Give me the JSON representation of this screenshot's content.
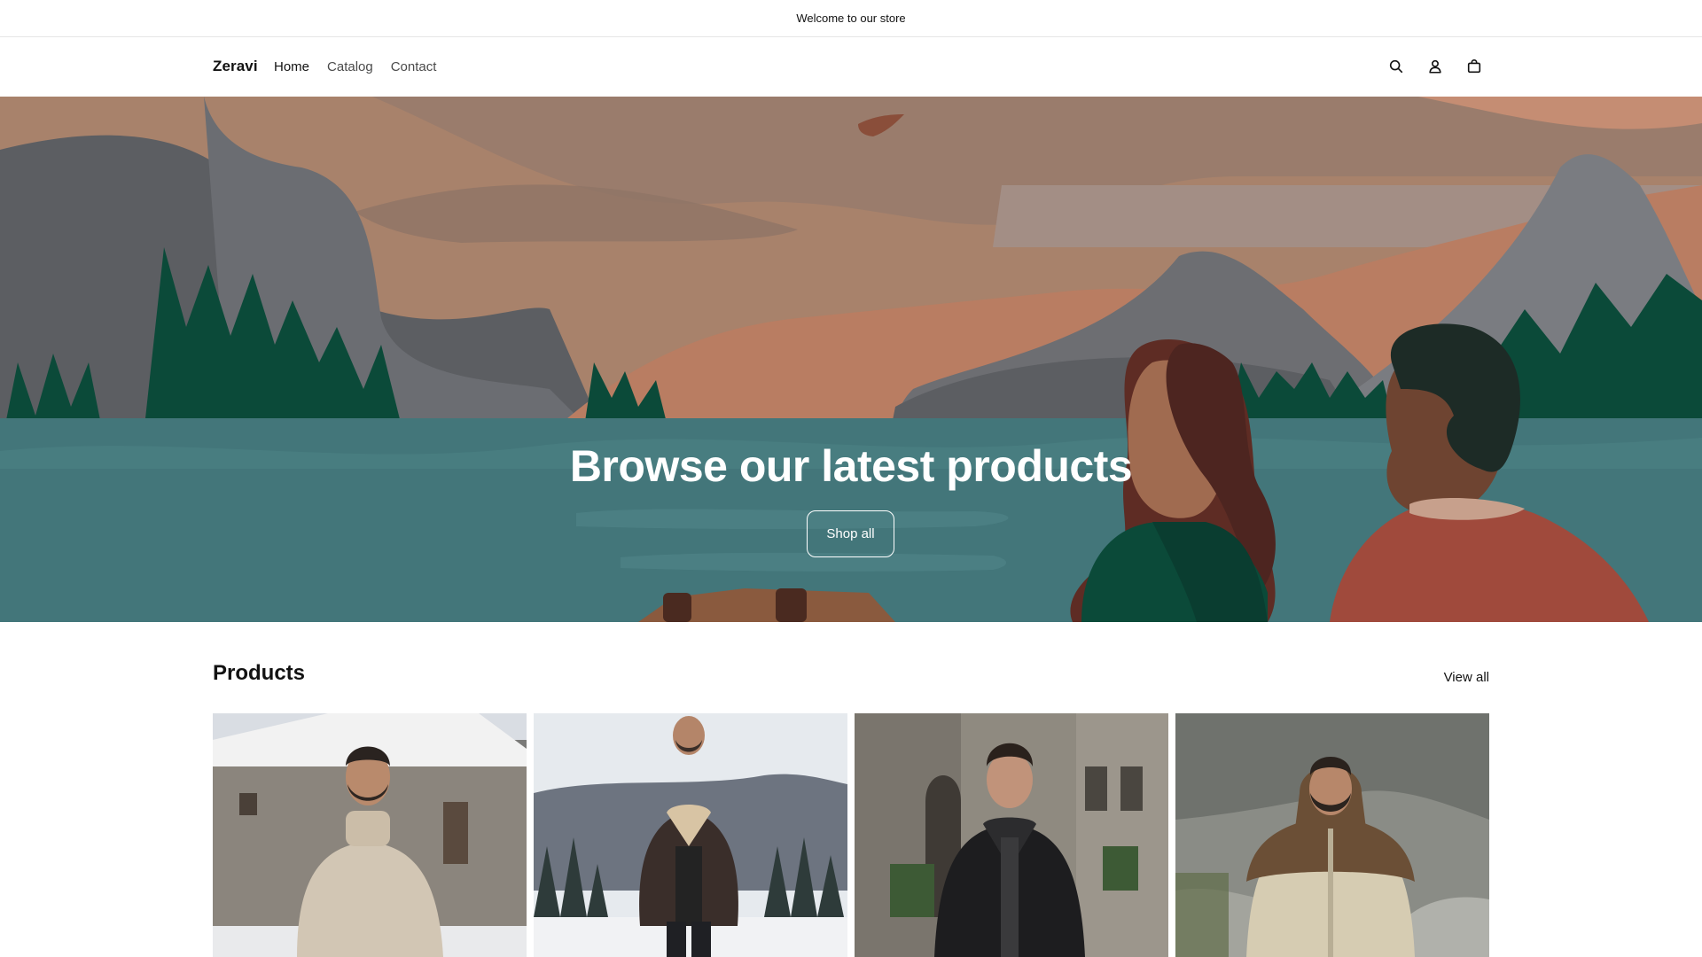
{
  "announcement": {
    "text": "Welcome to our store"
  },
  "header": {
    "logo": "Zeravi",
    "nav": [
      {
        "label": "Home",
        "active": true
      },
      {
        "label": "Catalog",
        "active": false
      },
      {
        "label": "Contact",
        "active": false
      }
    ],
    "icons": [
      "search-icon",
      "account-icon",
      "cart-icon"
    ]
  },
  "hero": {
    "title": "Browse our latest products",
    "button_label": "Shop all"
  },
  "products": {
    "title": "Products",
    "view_all_label": "View all",
    "items": [
      {
        "image": "man-turtleneck-sweater-stone-house-snow"
      },
      {
        "image": "man-shearling-jacket-snowy-forest"
      },
      {
        "image": "man-black-leather-jacket-old-street"
      },
      {
        "image": "man-puffer-jacket-rocky-mountain"
      }
    ]
  },
  "colors": {
    "text": "#121212",
    "hero_water": "#43767a",
    "hero_trees": "#0b4a39",
    "hero_sky": "#a8826b"
  }
}
